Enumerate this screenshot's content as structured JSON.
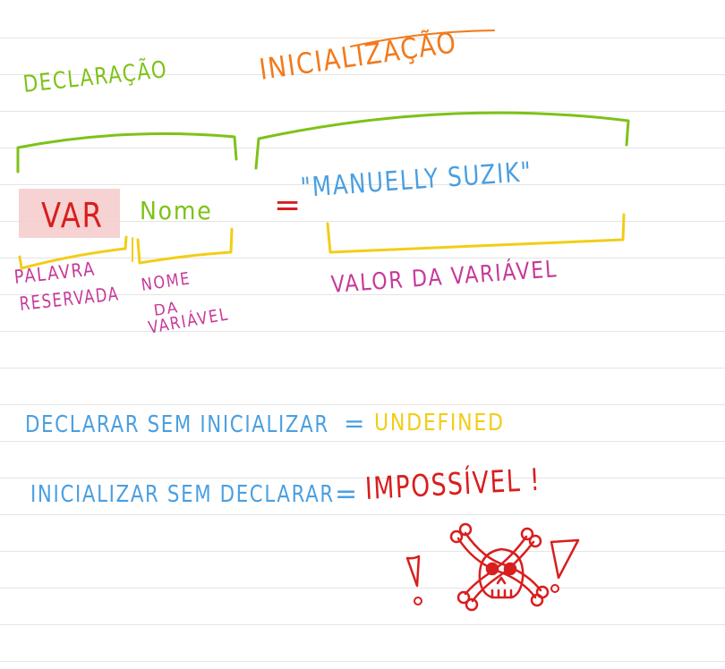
{
  "colors": {
    "green": "#7dc218",
    "orange": "#f27a1c",
    "red": "#d81e1e",
    "magenta": "#c7399a",
    "blue": "#4a9fe0",
    "yellow": "#f2cd17",
    "highlight": "#f5caca"
  },
  "headings": {
    "declaracao": "DECLARAÇÃO",
    "inicializacao": "INICIALIZAÇÃO"
  },
  "statement": {
    "keyword": "VAR",
    "name": "Nome",
    "equals": "=",
    "value": "\"MANUELLY SUZIK\""
  },
  "annotations": {
    "keyword_line1": "PALAVRA",
    "keyword_line2": "RESERVADA",
    "name_line1": "NOME",
    "name_line2": "DA",
    "name_line3": "VARIÁVEL",
    "value": "VALOR DA VARIÁVEL"
  },
  "rules": [
    {
      "left": "DECLARAR SEM INICIALIZAR",
      "equals": "=",
      "right": "UNDEFINED"
    },
    {
      "left": "INICIALIZAR SEM DECLARAR",
      "equals": "=",
      "right": "IMPOSSÍVEL !"
    }
  ],
  "icons": [
    "skull-crossbones-icon",
    "exclamation-icon"
  ]
}
